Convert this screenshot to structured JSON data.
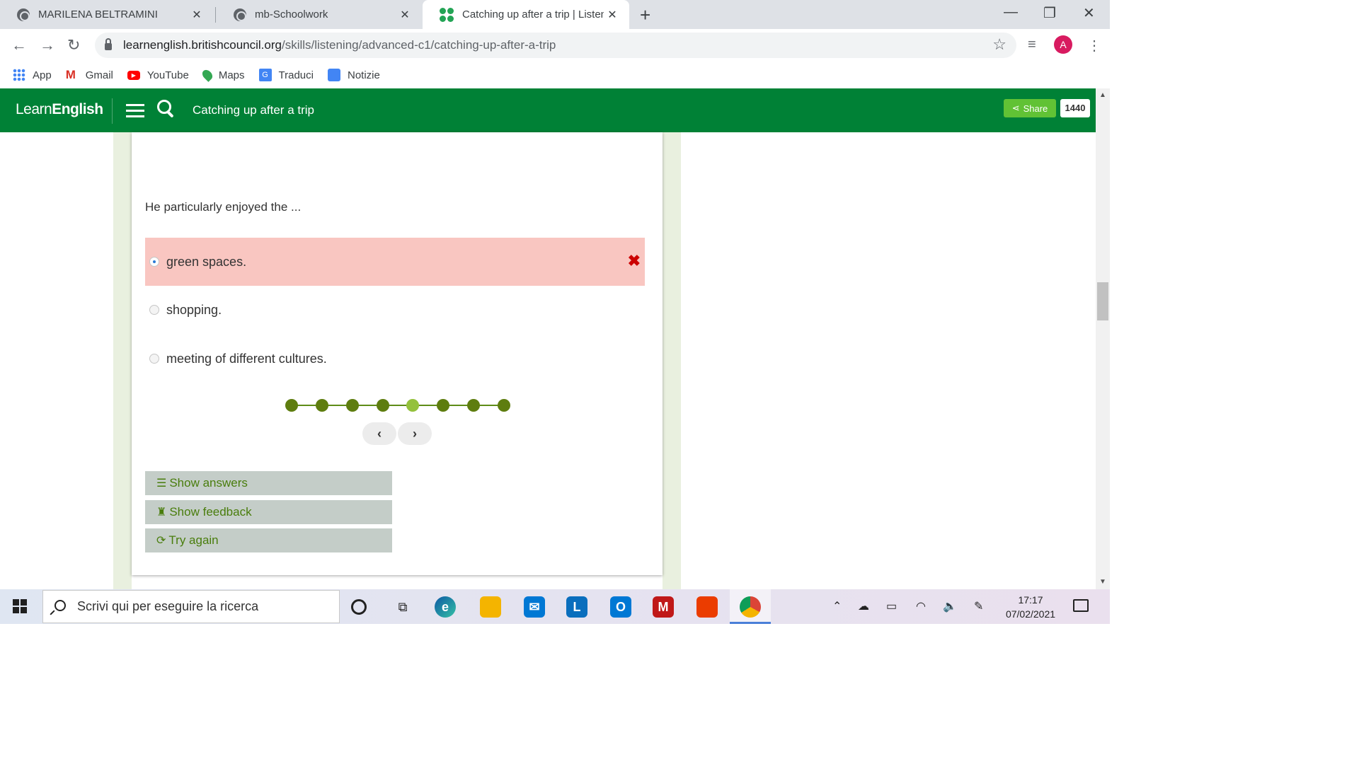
{
  "browser": {
    "tabs": [
      {
        "title": "MARILENA BELTRAMINI",
        "active": false
      },
      {
        "title": "mb-Schoolwork",
        "active": false
      },
      {
        "title": "Catching up after a trip | Listening",
        "active": true
      }
    ],
    "url_host": "learnenglish.britishcouncil.org",
    "url_path": "/skills/listening/advanced-c1/catching-up-after-a-trip",
    "profile_initial": "A",
    "bookmarks": [
      {
        "label": "App",
        "icon": "apps-grid-icon"
      },
      {
        "label": "Gmail",
        "icon": "gmail-icon"
      },
      {
        "label": "YouTube",
        "icon": "youtube-icon"
      },
      {
        "label": "Maps",
        "icon": "maps-pin-icon"
      },
      {
        "label": "Traduci",
        "icon": "translate-icon"
      },
      {
        "label": "Notizie",
        "icon": "news-icon"
      }
    ]
  },
  "site": {
    "logo_light": "Learn",
    "logo_bold": "English",
    "header_title": "Catching up after a trip",
    "share_label": "Share",
    "share_count": "1440",
    "brand_color": "#008136"
  },
  "exercise": {
    "question": "He particularly enjoyed the ...",
    "options": [
      {
        "text": "green spaces.",
        "selected": true,
        "state": "wrong"
      },
      {
        "text": "shopping.",
        "selected": false
      },
      {
        "text": "meeting of different cultures.",
        "selected": false
      }
    ],
    "progress": {
      "total": 8,
      "current_index": 5
    },
    "actions": {
      "show_answers": "Show answers",
      "show_feedback": "Show feedback",
      "try_again": "Try again"
    }
  },
  "taskbar": {
    "search_placeholder": "Scrivi qui per eseguire la ricerca",
    "time": "17:17",
    "date": "07/02/2021"
  }
}
